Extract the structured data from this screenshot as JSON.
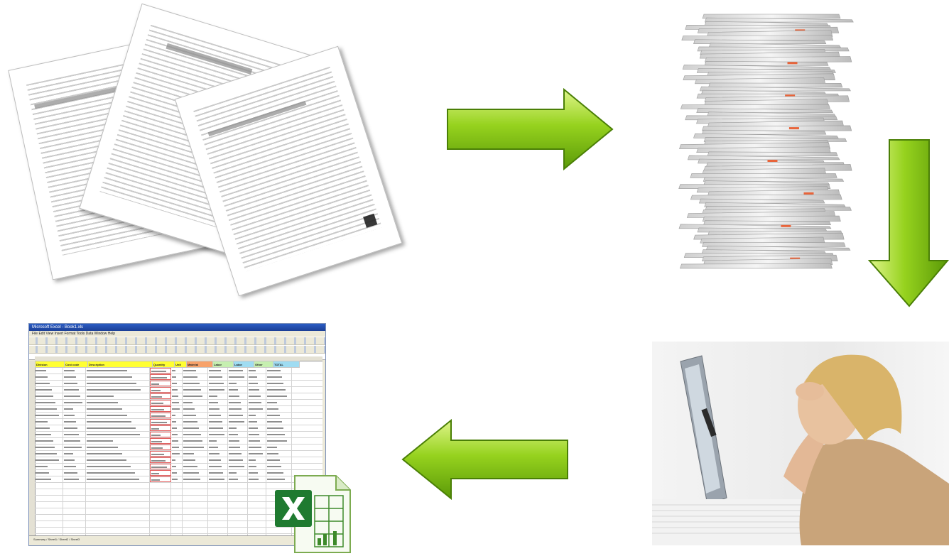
{
  "diagram": {
    "steps": [
      {
        "id": "paper-forms",
        "icon": "scattered-documents-icon"
      },
      {
        "id": "paper-stack",
        "icon": "paper-stack-icon"
      },
      {
        "id": "stressed-worker",
        "icon": "stressed-woman-photo"
      },
      {
        "id": "spreadsheet",
        "icon": "excel-spreadsheet-icon"
      }
    ],
    "arrow_color": "#8ccc1a",
    "arrow_dark": "#4f8a06",
    "arrow_light": "#d8f27a"
  },
  "excel_window": {
    "title": "Microsoft Excel - Book1.xls",
    "menu": "File  Edit  View  Insert  Format  Tools  Data  Window  Help",
    "sheet_tabs": "Summary / Sheet1 / Sheet2 / Sheet3",
    "header_cells": [
      "Division",
      "Cost code",
      "Description",
      "Quantity",
      "Unit",
      "Material",
      "Labor",
      "Labor",
      "Other",
      "TOTAL"
    ]
  }
}
